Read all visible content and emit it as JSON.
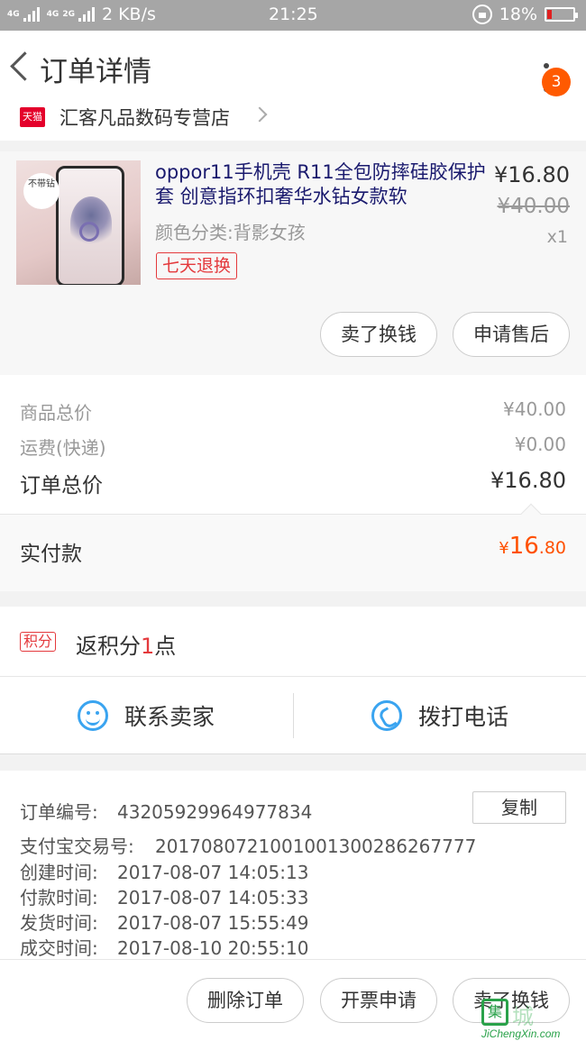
{
  "status_bar": {
    "network_label_1": "4G",
    "network_label_2": "4G",
    "network_label_3": "2G",
    "speed": "2 KB/s",
    "time": "21:25",
    "battery": "18%"
  },
  "header": {
    "title": "订单详情",
    "badge_count": "3"
  },
  "store": {
    "badge": "天猫",
    "name": "汇客凡品数码专营店"
  },
  "product": {
    "name": "oppor11手机壳 R11全包防摔硅胶保护套 创意指环扣奢华水钻女款软",
    "spec": "颜色分类:背影女孩",
    "return_tag": "七天退换",
    "price": "¥16.80",
    "original_price": "¥40.00",
    "quantity": "x1",
    "image_tag_text": "不带钻",
    "buttons": {
      "sell_label": "卖了换钱",
      "after_sale_label": "申请售后"
    }
  },
  "summary": {
    "goods_total_label": "商品总价",
    "goods_total_value": "¥40.00",
    "shipping_label": "运费(快递)",
    "shipping_value": "¥0.00",
    "order_total_label": "订单总价",
    "order_total_value": "¥16.80",
    "paid_label": "实付款",
    "paid_currency": "¥",
    "paid_int": "16",
    "paid_dec": ".80"
  },
  "points": {
    "badge": "积分",
    "prefix": "返积分",
    "count": "1",
    "suffix": "点"
  },
  "contact": {
    "seller_label": "联系卖家",
    "call_label": "拨打电话"
  },
  "order_info": {
    "order_no_label": "订单编号:",
    "order_no": "43205929964977834",
    "copy_label": "复制",
    "alipay_label": "支付宝交易号:",
    "alipay_no": "2017080721001001300286267777",
    "created_label": "创建时间:",
    "created": "2017-08-07 14:05:13",
    "paid_label": "付款时间:",
    "paid": "2017-08-07 14:05:33",
    "shipped_label": "发货时间:",
    "shipped": "2017-08-07 15:55:49",
    "completed_label": "成交时间:",
    "completed": "2017-08-10 20:55:10"
  },
  "bottom_bar": {
    "delete_label": "删除订单",
    "invoice_label": "开票申请",
    "sell_label": "卖了换钱"
  },
  "watermark": {
    "cn": "城",
    "en": "JiChengXin.com"
  },
  "colors": {
    "accent": "#ff5000",
    "red": "#e4393c",
    "blue_icon": "#3aa4f0",
    "status_bar": "#a6a6a6"
  }
}
